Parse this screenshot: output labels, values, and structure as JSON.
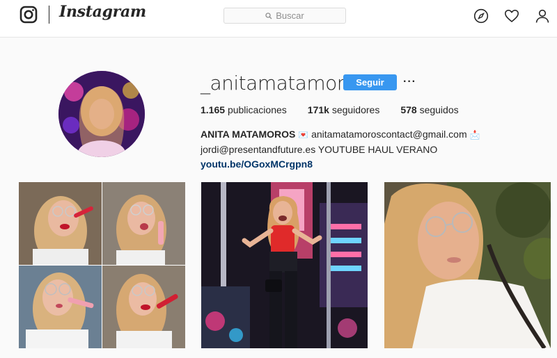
{
  "nav": {
    "wordmark": "Instagram",
    "search_placeholder": "Buscar",
    "icons": [
      "instagram-logo-icon",
      "compass-icon",
      "heart-icon",
      "profile-icon"
    ]
  },
  "profile": {
    "username": "_anitamatamoros",
    "follow_label": "Seguir",
    "more_label": "···",
    "stats": {
      "posts_count": "1.165",
      "posts_label": "publicaciones",
      "followers_count": "171k",
      "followers_label": "seguidores",
      "following_count": "578",
      "following_label": "seguidos"
    },
    "bio": {
      "name": "ANITA MATAMOROS",
      "email1": "anitamatamoroscontact@gmail.com",
      "line2_text": "jordi@presentandfuture.es YOUTUBE HAUL VERANO",
      "link": "youtu.be/OGoxMCrgpn8"
    }
  },
  "colors": {
    "accent": "#3897f0",
    "link": "#003569",
    "text": "#262626",
    "background": "#fafafa"
  },
  "posts": [
    {
      "description": "four-panel lip gloss selfie collage"
    },
    {
      "description": "amusement park ride photo"
    },
    {
      "description": "close-up selfie with glasses"
    }
  ]
}
